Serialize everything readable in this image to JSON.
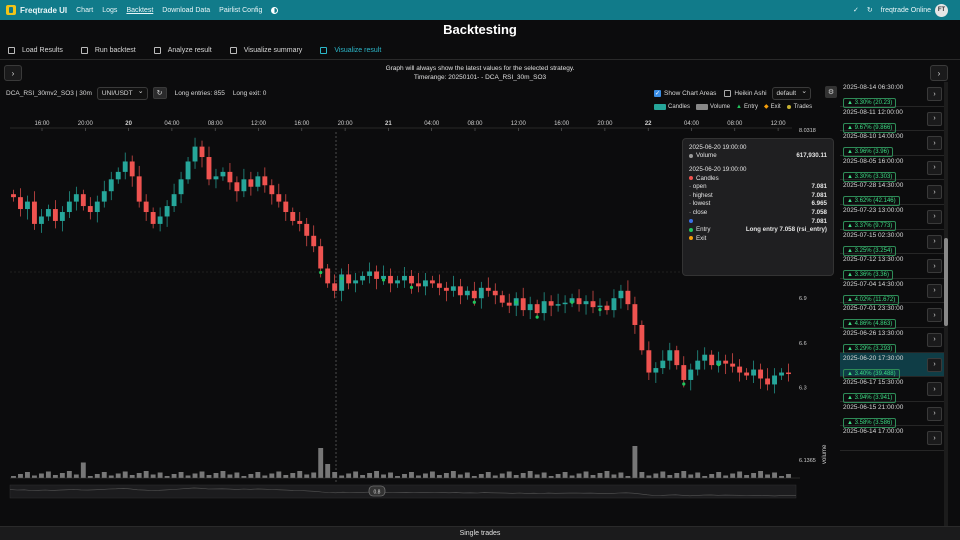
{
  "nav": {
    "brand": "Freqtrade UI",
    "links": [
      "Chart",
      "Logs",
      "Backtest",
      "Download Data",
      "Pairlist Config"
    ],
    "active_link": "Backtest",
    "status": "freqtrade Online",
    "avatar": "FT"
  },
  "page_title": "Backtesting",
  "tabs": [
    {
      "label": "Load Results",
      "icon": "folder-icon"
    },
    {
      "label": "Run backtest",
      "icon": "play-icon"
    },
    {
      "label": "Analyze result",
      "icon": "table-icon"
    },
    {
      "label": "Visualize summary",
      "icon": "chart-icon"
    },
    {
      "label": "Visualize result",
      "icon": "chart-line-icon"
    }
  ],
  "info": {
    "line1": "Graph will always show the latest values for the selected strategy.",
    "line2": "Timerange: 20250101- - DCA_RSI_30m_SO3"
  },
  "controls": {
    "strategy_label": "DCA_RSI_30mv2_SO3 | 30m",
    "pair": "UNI/USDT",
    "long_entries": "Long entries: 855",
    "long_exit": "Long exit: 0",
    "show_chart_areas": "Show Chart Areas",
    "heikin_ashi": "Heikin Ashi",
    "config_select": "default"
  },
  "legend": [
    {
      "label": "Candles",
      "color": "#26a69a",
      "shape": "rect"
    },
    {
      "label": "Volume",
      "color": "#888888",
      "shape": "rect"
    },
    {
      "label": "Entry",
      "color": "#22c55e",
      "shape": "tri"
    },
    {
      "label": "Exit",
      "color": "#f59e0b",
      "shape": "diamond"
    },
    {
      "label": "Trades",
      "color": "#c7b233",
      "shape": "dot"
    }
  ],
  "axis": {
    "x_ticks": [
      "16:00",
      "20:00",
      "20",
      "04:00",
      "08:00",
      "12:00",
      "16:00",
      "20:00",
      "21",
      "04:00",
      "08:00",
      "12:00",
      "16:00",
      "20:00",
      "22",
      "04:00",
      "08:00",
      "12:00"
    ],
    "y_ticks": [
      "8.0318",
      "6.9",
      "6.6",
      "6.3",
      "6.1365"
    ],
    "volume_label": "volume",
    "slider_label": "0.8"
  },
  "tooltip": {
    "time1": "2025-06-20 19:00:00",
    "volume_label": "Volume",
    "volume_value": "617,930.11",
    "time2": "2025-06-20 19:00:00",
    "candles_label": "Candles",
    "rows": [
      {
        "label": "open",
        "value": "7.081"
      },
      {
        "label": "highest",
        "value": "7.081"
      },
      {
        "label": "lowest",
        "value": "6.965"
      },
      {
        "label": "close",
        "value": "7.058"
      }
    ],
    "blank_value": "7.081",
    "entry_label": "Entry",
    "entry_value": "Long entry 7.058 (rsi_entry)",
    "exit_label": "Exit"
  },
  "trades": [
    {
      "date": "2025-08-14 06:30:00",
      "profit": "3.30% (20.23)"
    },
    {
      "date": "2025-08-11 12:00:00",
      "profit": "9.67% (9.866)"
    },
    {
      "date": "2025-08-10 14:00:00",
      "profit": "3.96% (3.96)"
    },
    {
      "date": "2025-08-05 16:00:00",
      "profit": "3.30% (3.303)"
    },
    {
      "date": "2025-07-28 14:30:00",
      "profit": "3.62% (42.146)"
    },
    {
      "date": "2025-07-23 13:00:00",
      "profit": "3.37% (9.773)"
    },
    {
      "date": "2025-07-15 02:30:00",
      "profit": "3.25% (3.254)"
    },
    {
      "date": "2025-07-12 13:30:00",
      "profit": "3.36% (3.36)"
    },
    {
      "date": "2025-07-04 14:30:00",
      "profit": "4.02% (11.672)"
    },
    {
      "date": "2025-07-01 23:30:00",
      "profit": "4.86% (4.863)"
    },
    {
      "date": "2025-06-26 13:30:00",
      "profit": "3.29% (3.293)"
    },
    {
      "date": "2025-06-20 17:30:00",
      "profit": "3.40% (39.488)",
      "active": true
    },
    {
      "date": "2025-06-17 15:30:00",
      "profit": "3.94% (3.941)"
    },
    {
      "date": "2025-06-15 21:00:00",
      "profit": "3.58% (3.586)"
    },
    {
      "date": "2025-06-14 17:00:00",
      "profit": ""
    }
  ],
  "footer": "Single trades",
  "chart_data": {
    "type": "candlestick",
    "ylim": [
      6.1365,
      8.0318
    ],
    "close": [
      7.58,
      7.5,
      7.55,
      7.4,
      7.45,
      7.5,
      7.42,
      7.48,
      7.55,
      7.6,
      7.52,
      7.48,
      7.55,
      7.62,
      7.7,
      7.75,
      7.82,
      7.72,
      7.55,
      7.48,
      7.4,
      7.45,
      7.52,
      7.6,
      7.7,
      7.82,
      7.92,
      7.85,
      7.7,
      7.72,
      7.75,
      7.68,
      7.62,
      7.7,
      7.65,
      7.72,
      7.66,
      7.6,
      7.55,
      7.48,
      7.42,
      7.4,
      7.32,
      7.25,
      7.1,
      7.0,
      6.95,
      7.06,
      7.0,
      7.02,
      7.05,
      7.08,
      7.03,
      7.05,
      7.0,
      7.02,
      7.05,
      7.0,
      6.98,
      7.02,
      7.0,
      6.97,
      6.95,
      6.98,
      6.92,
      6.95,
      6.9,
      6.97,
      6.95,
      6.92,
      6.87,
      6.85,
      6.9,
      6.82,
      6.86,
      6.8,
      6.88,
      6.85,
      6.86,
      6.87,
      6.9,
      6.86,
      6.88,
      6.84,
      6.85,
      6.82,
      6.9,
      6.95,
      6.86,
      6.72,
      6.55,
      6.4,
      6.43,
      6.48,
      6.55,
      6.45,
      6.35,
      6.42,
      6.48,
      6.52,
      6.45,
      6.48,
      6.46,
      6.44,
      6.4,
      6.38,
      6.42,
      6.36,
      6.32,
      6.38,
      6.4,
      6.39
    ]
  }
}
